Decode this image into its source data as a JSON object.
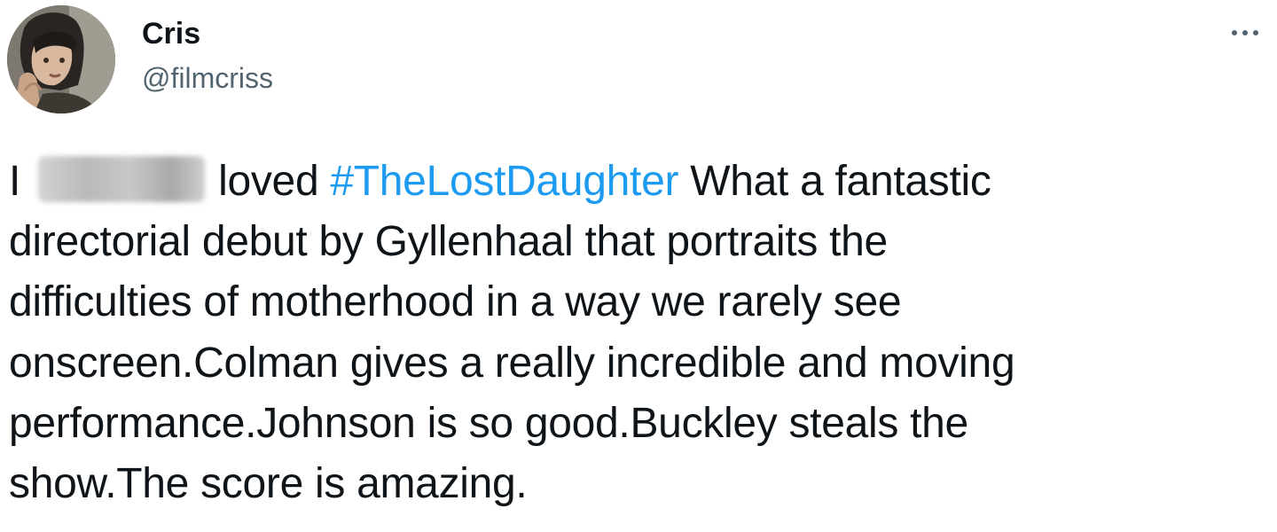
{
  "author": {
    "display_name": "Cris",
    "handle": "@filmcriss",
    "avatar_icon": "profile-photo"
  },
  "more_options": {
    "icon": "more-horizontal-icon"
  },
  "colors": {
    "text": "#0f1419",
    "secondary_text": "#536471",
    "hashtag": "#1d9bf0",
    "background": "#ffffff"
  },
  "tweet": {
    "line1_before": "I",
    "line1_after": " loved ",
    "hashtag": "#TheLostDaughter",
    "line1_end": " What a fantastic",
    "line2": "directorial debut by Gyllenhaal that portraits the",
    "line3": "difficulties of motherhood in a way we rarely see",
    "line4": "onscreen.Colman gives a really incredible and moving",
    "line5": "performance.Johnson is so good.Buckley steals the",
    "line6": "show.The score is amazing."
  }
}
